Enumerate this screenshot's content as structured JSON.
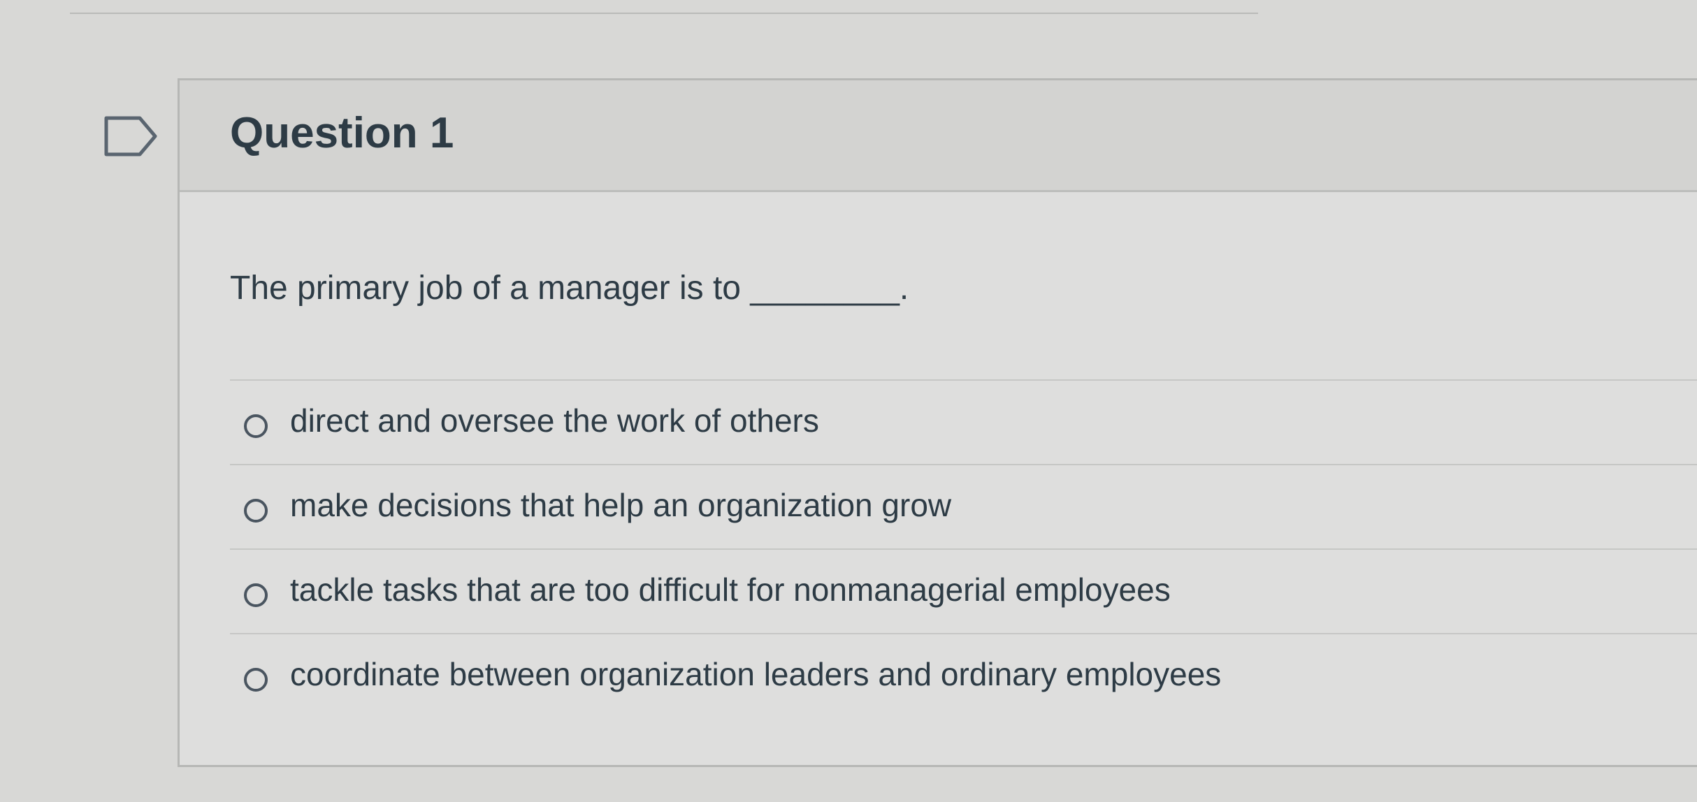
{
  "quiz": {
    "question_title": "Question 1",
    "question_text": "The primary job of a manager is to ________.",
    "answers": [
      {
        "label": "direct and oversee the work of others",
        "selected": false
      },
      {
        "label": "make decisions that help an organization grow",
        "selected": false
      },
      {
        "label": "tackle tasks that are too difficult for nonmanagerial employees",
        "selected": false
      },
      {
        "label": "coordinate between organization leaders and ordinary employees",
        "selected": false
      }
    ],
    "icons": {
      "flag": "flag-question-icon",
      "radio": "radio-button-icon"
    },
    "colors": {
      "text": "#2d3b45",
      "header_bg": "#d3d3d1",
      "card_bg": "#dededd",
      "border": "#b6b7b5"
    }
  }
}
